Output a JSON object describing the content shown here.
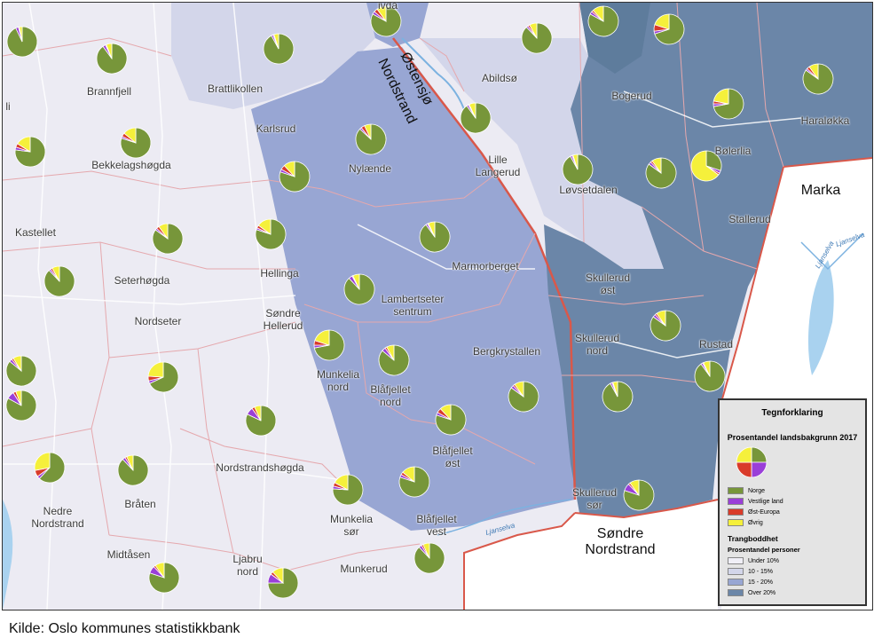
{
  "map": {
    "pie_colors": {
      "norge": "#77963a",
      "vestlige": "#9a3fd8",
      "ost_europa": "#d93b2a",
      "ovrig": "#f5f03b"
    },
    "area_labels": [
      {
        "id": "brannfjell",
        "text": "Brannfjell"
      },
      {
        "id": "brattlikollen",
        "text": "Brattlikollen"
      },
      {
        "id": "abildso",
        "text": "Abildsø"
      },
      {
        "id": "bogerud",
        "text": "Bogerud"
      },
      {
        "id": "haralokka",
        "text": "Haraløkka"
      },
      {
        "id": "karlsrud",
        "text": "Karlsrud"
      },
      {
        "id": "nylaende",
        "text": "Nylænde"
      },
      {
        "id": "lille-langerud",
        "text": "Lille\nLangerud"
      },
      {
        "id": "bolerlia",
        "text": "Bølerlia"
      },
      {
        "id": "bekkelagshogda",
        "text": "Bekkelagshøgda"
      },
      {
        "id": "lovsetdalen",
        "text": "Løvsetdalen"
      },
      {
        "id": "stallerud",
        "text": "Stallerud"
      },
      {
        "id": "kastellet",
        "text": "Kastellet"
      },
      {
        "id": "marmorberget",
        "text": "Marmorberget"
      },
      {
        "id": "hellinga",
        "text": "Hellinga"
      },
      {
        "id": "skullerud-ost",
        "text": "Skullerud\nøst"
      },
      {
        "id": "seterhogda",
        "text": "Seterhøgda"
      },
      {
        "id": "lambertseter-sentrum",
        "text": "Lambertseter\nsentrum"
      },
      {
        "id": "sondre-hellerud",
        "text": "Søndre\nHellerud"
      },
      {
        "id": "nordseter",
        "text": "Nordseter"
      },
      {
        "id": "skullerud-nord",
        "text": "Skullerud\nnord"
      },
      {
        "id": "rustad",
        "text": "Rustad"
      },
      {
        "id": "bergkrystallen",
        "text": "Bergkrystallen"
      },
      {
        "id": "munkelia-nord",
        "text": "Munkelia\nnord"
      },
      {
        "id": "blafjellet-nord",
        "text": "Blåfjellet\nnord"
      },
      {
        "id": "blafjellet-ost",
        "text": "Blåfjellet\nøst"
      },
      {
        "id": "nordstrandshogda",
        "text": "Nordstrandshøgda"
      },
      {
        "id": "braten",
        "text": "Bråten"
      },
      {
        "id": "nedre-nordstrand",
        "text": "Nedre\nNordstrand"
      },
      {
        "id": "munkelia-sor",
        "text": "Munkelia\nsør"
      },
      {
        "id": "blafjellet-vest",
        "text": "Blåfjellet\nvest"
      },
      {
        "id": "skullerud-sor",
        "text": "Skullerud\nsør"
      },
      {
        "id": "midtasen",
        "text": "Midtåsen"
      },
      {
        "id": "ljabru-nord",
        "text": "Ljabru\nnord"
      },
      {
        "id": "munkerud",
        "text": "Munkerud"
      },
      {
        "id": "li-partial",
        "text": "li"
      },
      {
        "id": "top-partial",
        "text": "ivda"
      }
    ],
    "region_labels": {
      "marka": "Marka",
      "sondre_nordstrand": "Søndre\nNordstrand",
      "nordstrand": "Nordstrand",
      "ostensjo": "Østensjø"
    },
    "river_labels": [
      "Ljanselva",
      "Ljanselva",
      "Ljanselva"
    ],
    "pies": [
      {
        "norge": 0.93,
        "vestlige": 0.03,
        "ost_europa": 0.01,
        "ovrig": 0.03
      },
      {
        "norge": 0.9,
        "vestlige": 0.03,
        "ost_europa": 0.01,
        "ovrig": 0.06
      },
      {
        "norge": 0.92,
        "vestlige": 0.02,
        "ost_europa": 0.01,
        "ovrig": 0.05
      },
      {
        "norge": 0.83,
        "vestlige": 0.03,
        "ost_europa": 0.04,
        "ovrig": 0.1
      },
      {
        "norge": 0.88,
        "vestlige": 0.02,
        "ost_europa": 0.02,
        "ovrig": 0.08
      },
      {
        "norge": 0.83,
        "vestlige": 0.03,
        "ost_europa": 0.02,
        "ovrig": 0.12
      },
      {
        "norge": 0.7,
        "vestlige": 0.03,
        "ost_europa": 0.07,
        "ovrig": 0.2
      },
      {
        "norge": 0.85,
        "vestlige": 0.02,
        "ost_europa": 0.03,
        "ovrig": 0.1
      },
      {
        "norge": 0.72,
        "vestlige": 0.03,
        "ost_europa": 0.03,
        "ovrig": 0.22
      },
      {
        "norge": 0.9,
        "vestlige": 0.02,
        "ost_europa": 0.01,
        "ovrig": 0.07
      },
      {
        "norge": 0.87,
        "vestlige": 0.02,
        "ost_europa": 0.04,
        "ovrig": 0.07
      },
      {
        "norge": 0.77,
        "vestlige": 0.03,
        "ost_europa": 0.04,
        "ovrig": 0.16
      },
      {
        "norge": 0.8,
        "vestlige": 0.02,
        "ost_europa": 0.04,
        "ovrig": 0.14
      },
      {
        "norge": 0.8,
        "vestlige": 0.03,
        "ost_europa": 0.05,
        "ovrig": 0.12
      },
      {
        "norge": 0.92,
        "vestlige": 0.02,
        "ost_europa": 0.01,
        "ovrig": 0.05
      },
      {
        "norge": 0.85,
        "vestlige": 0.03,
        "ost_europa": 0.02,
        "ovrig": 0.1
      },
      {
        "norge": 0.3,
        "vestlige": 0.03,
        "ost_europa": 0.02,
        "ovrig": 0.65
      },
      {
        "norge": 0.8,
        "vestlige": 0.02,
        "ost_europa": 0.03,
        "ovrig": 0.15
      },
      {
        "norge": 0.9,
        "vestlige": 0.02,
        "ost_europa": 0.01,
        "ovrig": 0.07
      },
      {
        "norge": 0.85,
        "vestlige": 0.02,
        "ost_europa": 0.03,
        "ovrig": 0.1
      },
      {
        "norge": 0.88,
        "vestlige": 0.02,
        "ost_europa": 0.02,
        "ovrig": 0.08
      },
      {
        "norge": 0.88,
        "vestlige": 0.04,
        "ost_europa": 0.01,
        "ovrig": 0.07
      },
      {
        "norge": 0.85,
        "vestlige": 0.03,
        "ost_europa": 0.02,
        "ovrig": 0.1
      },
      {
        "norge": 0.72,
        "vestlige": 0.03,
        "ost_europa": 0.05,
        "ovrig": 0.2
      },
      {
        "norge": 0.86,
        "vestlige": 0.04,
        "ost_europa": 0.02,
        "ovrig": 0.08
      },
      {
        "norge": 0.86,
        "vestlige": 0.03,
        "ost_europa": 0.02,
        "ovrig": 0.09
      },
      {
        "norge": 0.68,
        "vestlige": 0.03,
        "ost_europa": 0.05,
        "ovrig": 0.24
      },
      {
        "norge": 0.9,
        "vestlige": 0.02,
        "ost_europa": 0.01,
        "ovrig": 0.07
      },
      {
        "norge": 0.85,
        "vestlige": 0.03,
        "ost_europa": 0.02,
        "ovrig": 0.1
      },
      {
        "norge": 0.92,
        "vestlige": 0.02,
        "ost_europa": 0.01,
        "ovrig": 0.05
      },
      {
        "norge": 0.83,
        "vestlige": 0.08,
        "ost_europa": 0.03,
        "ovrig": 0.06
      },
      {
        "norge": 0.82,
        "vestlige": 0.08,
        "ost_europa": 0.03,
        "ovrig": 0.07
      },
      {
        "norge": 0.8,
        "vestlige": 0.03,
        "ost_europa": 0.05,
        "ovrig": 0.12
      },
      {
        "norge": 0.62,
        "vestlige": 0.03,
        "ost_europa": 0.07,
        "ovrig": 0.28
      },
      {
        "norge": 0.88,
        "vestlige": 0.03,
        "ost_europa": 0.02,
        "ovrig": 0.07
      },
      {
        "norge": 0.8,
        "vestlige": 0.03,
        "ost_europa": 0.03,
        "ovrig": 0.14
      },
      {
        "norge": 0.76,
        "vestlige": 0.03,
        "ost_europa": 0.04,
        "ovrig": 0.17
      },
      {
        "norge": 0.8,
        "vestlige": 0.08,
        "ost_europa": 0.02,
        "ovrig": 0.1
      },
      {
        "norge": 0.8,
        "vestlige": 0.08,
        "ost_europa": 0.02,
        "ovrig": 0.1
      },
      {
        "norge": 0.75,
        "vestlige": 0.1,
        "ost_europa": 0.03,
        "ovrig": 0.12
      },
      {
        "norge": 0.88,
        "vestlige": 0.03,
        "ost_europa": 0.02,
        "ovrig": 0.07
      },
      {
        "norge": 0.9,
        "vestlige": 0.02,
        "ost_europa": 0.01,
        "ovrig": 0.07
      },
      {
        "norge": 0.82,
        "vestlige": 0.03,
        "ost_europa": 0.02,
        "ovrig": 0.13
      },
      {
        "norge": 0.85,
        "vestlige": 0.03,
        "ost_europa": 0.02,
        "ovrig": 0.1
      },
      {
        "norge": 0.8,
        "vestlige": 0.08,
        "ost_europa": 0.04,
        "ovrig": 0.08
      },
      {
        "norge": 0.4,
        "vestlige": 0.02,
        "ost_europa": 0.03,
        "ovrig": 0.55
      },
      {
        "norge": 0.9,
        "vestlige": 0.02,
        "ost_europa": 0.01,
        "ovrig": 0.07
      },
      {
        "norge": 0.9,
        "vestlige": 0.02,
        "ost_europa": 0.01,
        "ovrig": 0.07
      }
    ]
  },
  "legend": {
    "title": "Tegnforklaring",
    "subtitle": "Prosentandel landsbakgrunn 2017",
    "sample_pie": {
      "norge": 0.25,
      "vestlige": 0.25,
      "ost_europa": 0.25,
      "ovrig": 0.25
    },
    "items": [
      {
        "label": "Norge",
        "color": "#77963a"
      },
      {
        "label": "Vestlige land",
        "color": "#9a3fd8"
      },
      {
        "label": "Øst-Europa",
        "color": "#d93b2a"
      },
      {
        "label": "Øvrig",
        "color": "#f5f03b"
      }
    ],
    "crowding_title": "Trangboddhet",
    "crowding_subtitle": "Prosentandel personer",
    "crowding_items": [
      {
        "label": "Under 10%",
        "color": "#f0eff7"
      },
      {
        "label": "10 - 15%",
        "color": "#d3d6ea"
      },
      {
        "label": "15 - 20%",
        "color": "#98a6d3"
      },
      {
        "label": "Over 20%",
        "color": "#6b86a8"
      }
    ]
  },
  "source": "Kilde: Oslo kommunes statistikkbank"
}
